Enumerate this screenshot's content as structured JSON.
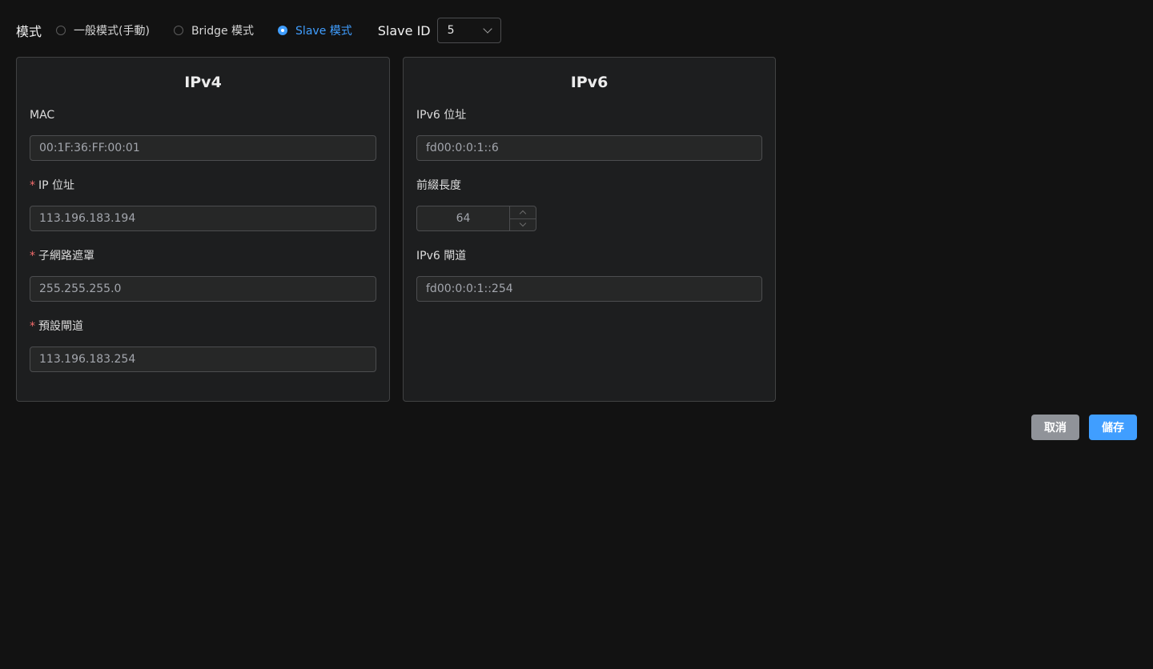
{
  "mode": {
    "label": "模式",
    "options": [
      {
        "label": "一般模式(手動)",
        "checked": false
      },
      {
        "label": "Bridge 模式",
        "checked": false
      },
      {
        "label": "Slave 模式",
        "checked": true
      }
    ]
  },
  "slave_id": {
    "label": "Slave ID",
    "value": "5"
  },
  "ipv4": {
    "title": "IPv4",
    "mac": {
      "label": "MAC",
      "value": "00:1F:36:FF:00:01"
    },
    "ip": {
      "required_mark": "*",
      "label": "IP 位址",
      "value": "113.196.183.194"
    },
    "subnet": {
      "required_mark": "*",
      "label": "子網路遮罩",
      "value": "255.255.255.0"
    },
    "gateway": {
      "required_mark": "*",
      "label": "預設閘道",
      "value": "113.196.183.254"
    }
  },
  "ipv6": {
    "title": "IPv6",
    "address": {
      "label": "IPv6 位址",
      "value": "fd00:0:0:1::6"
    },
    "prefix": {
      "label": "前綴長度",
      "value": "64"
    },
    "gateway": {
      "label": "IPv6 閘道",
      "value": "fd00:0:0:1::254"
    }
  },
  "actions": {
    "cancel": "取消",
    "save": "儲存"
  },
  "colors": {
    "accent": "#409eff",
    "required": "#f56c6c",
    "cancel_bg": "#909399",
    "background": "#121212",
    "card_bg": "#1d1e1f"
  }
}
